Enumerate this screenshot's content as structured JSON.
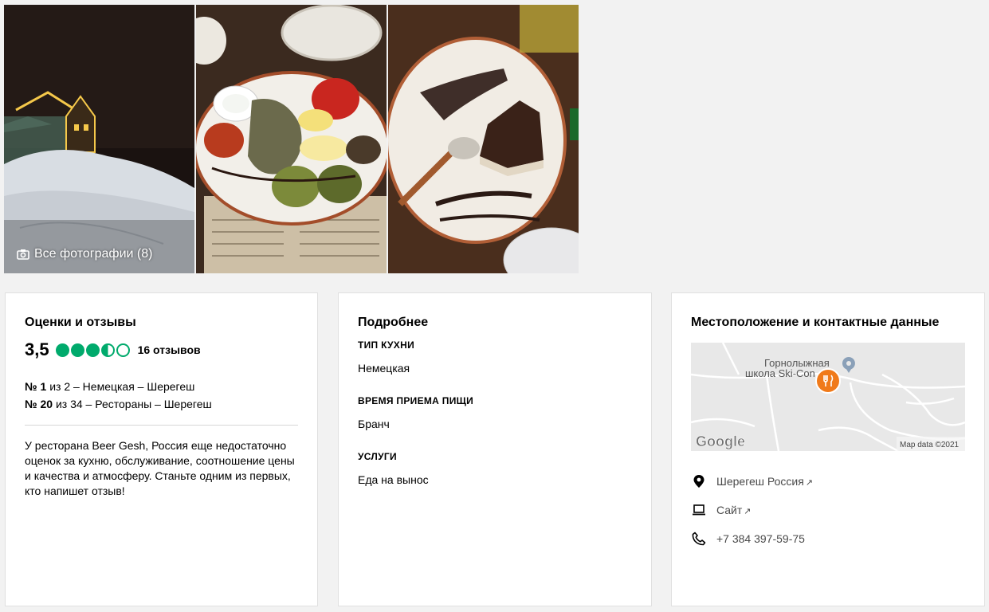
{
  "photos": {
    "all_photos_label": "Все фотографии (8)"
  },
  "ratings": {
    "title": "Оценки и отзывы",
    "score": "3,5",
    "bubbles": 3.5,
    "bubbles_max": 5,
    "review_count": "16 отзывов",
    "ranks": [
      {
        "num": "№ 1",
        "text": "из 2 – Немецкая – Шерегеш"
      },
      {
        "num": "№ 20",
        "text": "из 34 – Рестораны – Шерегеш"
      }
    ],
    "description": "У ресторана Beer Gesh, Россия еще недостаточно оценок за кухню, обслуживание, соотношение цены и качества и атмосферу. Станьте одним из первых, кто напишет отзыв!"
  },
  "details": {
    "title": "Подробнее",
    "cuisine_label": "ТИП КУХНИ",
    "cuisine_value": "Немецкая",
    "meals_label": "ВРЕМЯ ПРИЕМА ПИЩИ",
    "meals_value": "Бранч",
    "services_label": "УСЛУГИ",
    "services_value": "Еда на вынос"
  },
  "location": {
    "title": "Местоположение и контактные данные",
    "map_label_1": "Горнолыжная",
    "map_label_2": "школа Ski-Con",
    "map_logo": "Google",
    "map_data": "Map data ©2021",
    "address": "Шерегеш Россия",
    "website": "Сайт",
    "phone": "+7 384 397-59-75"
  },
  "colors": {
    "bubble": "#00aa6c",
    "map_pin": "#f07a1a"
  }
}
